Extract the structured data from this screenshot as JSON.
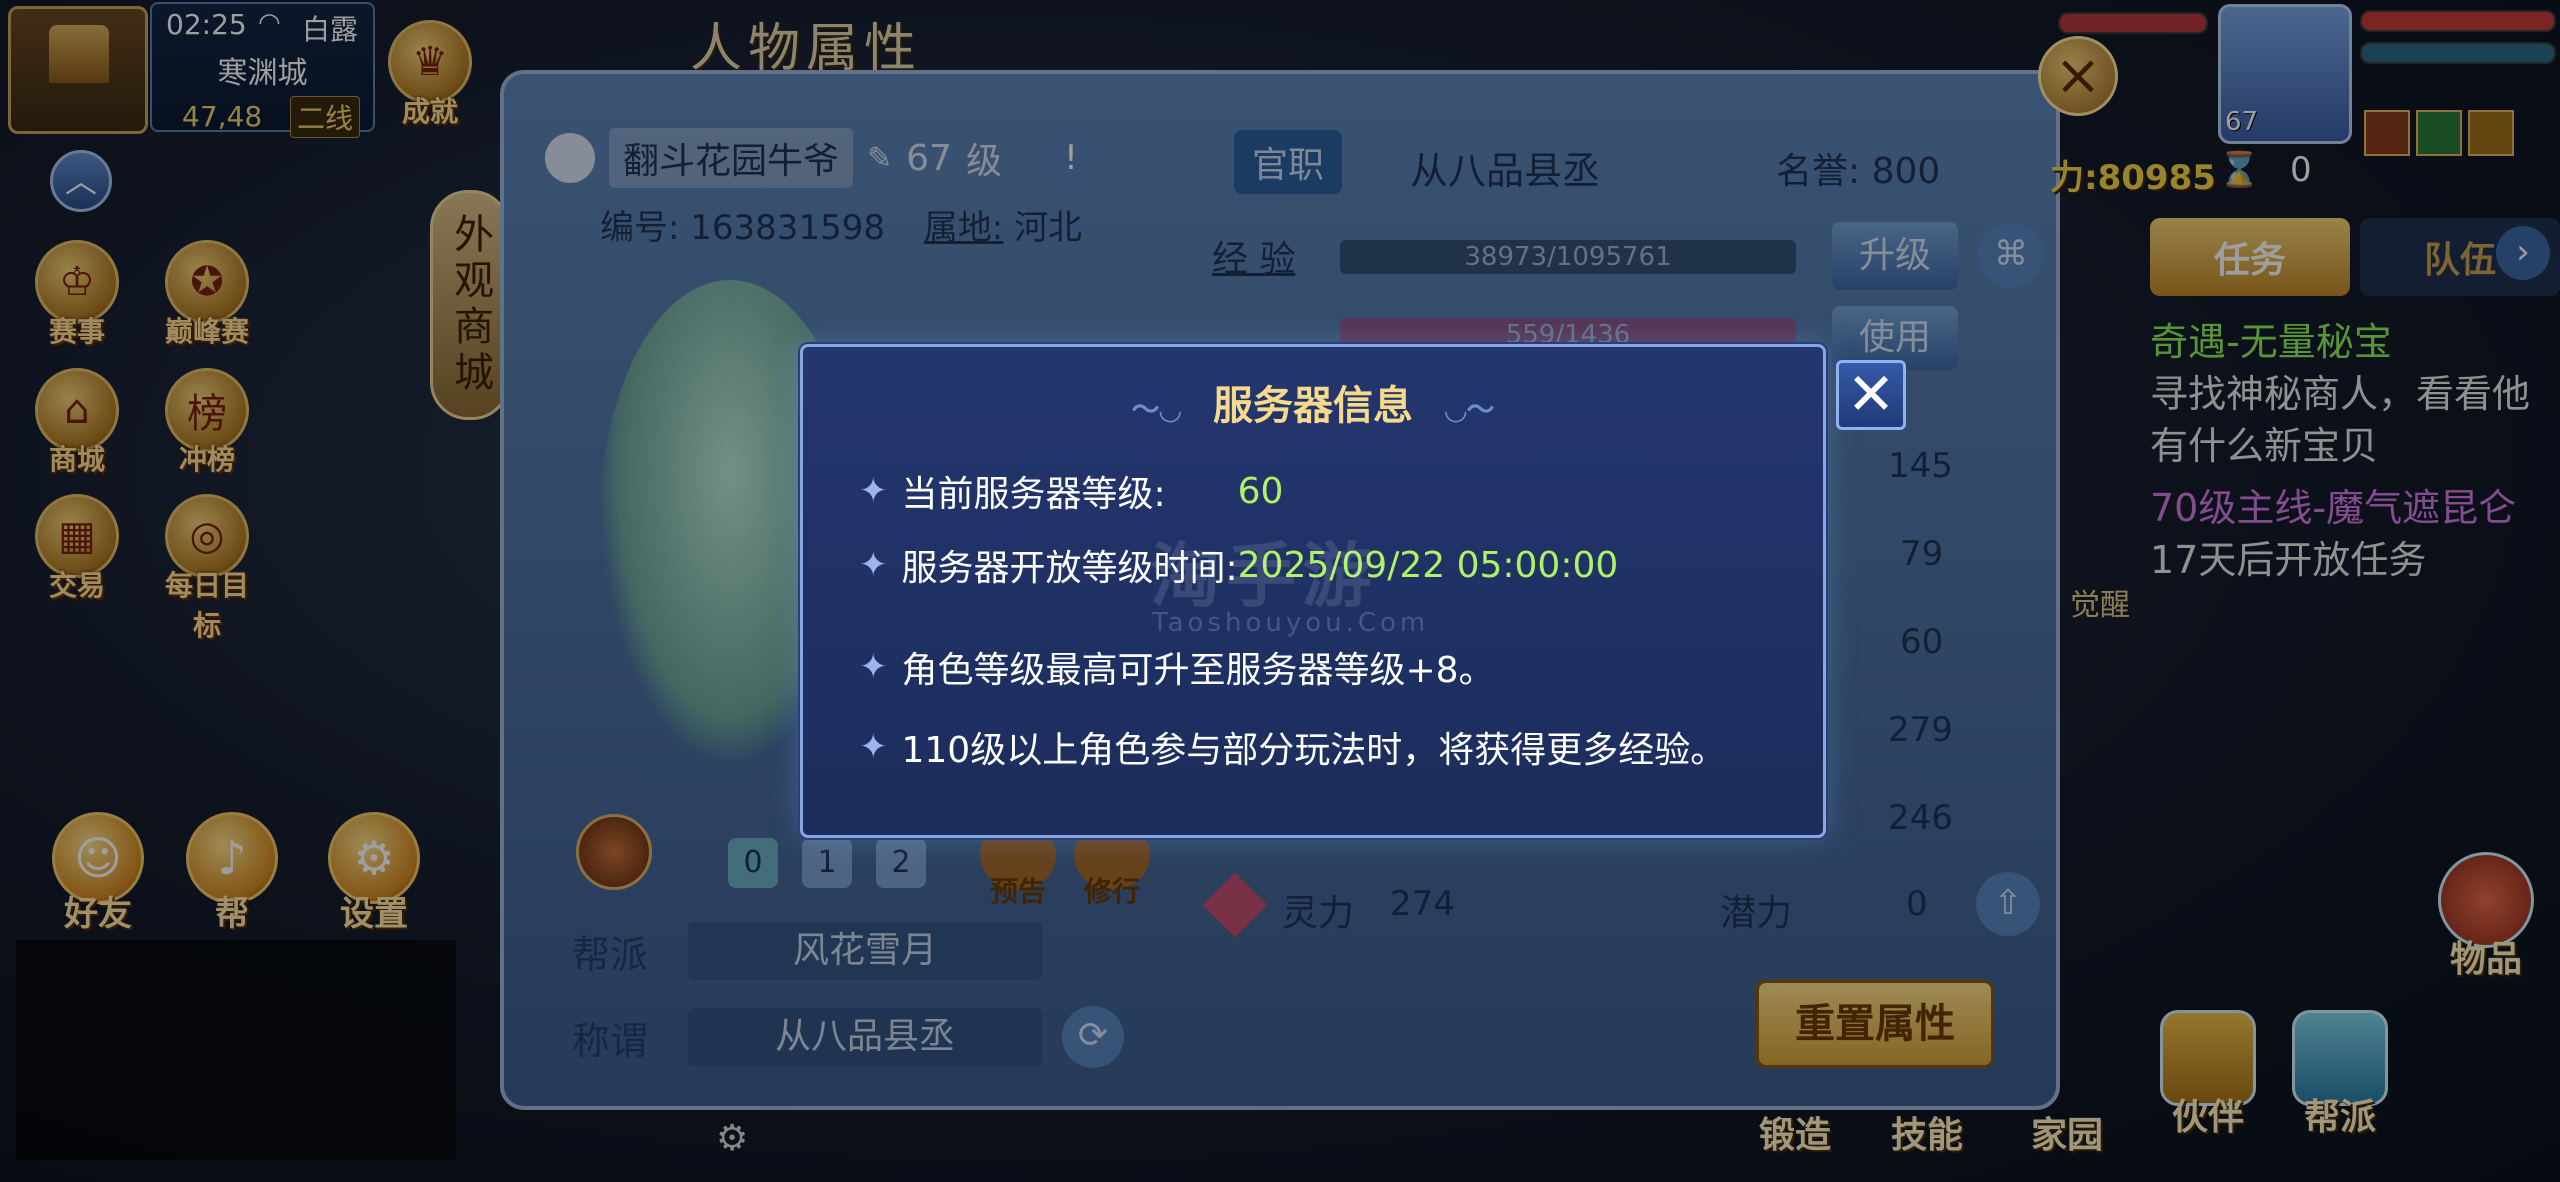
{
  "status_bar": {
    "time": "02:25",
    "weather": "白露",
    "city": "寒渊城",
    "coords": "47,48",
    "line": "二线"
  },
  "left_menu": {
    "achievement": "成就",
    "events": "赛事",
    "peak": "巅峰赛",
    "shop": "商城",
    "ranking": "冲榜",
    "trade": "交易",
    "daily_goal": "每日目标",
    "appearance_shop": "外观商城",
    "friends": "好友",
    "help": "帮",
    "settings": "设置"
  },
  "attribute_panel": {
    "title": "人物属性",
    "player_name": "翻斗花园牛爷",
    "level_num": "67",
    "level_unit": "级",
    "id_label": "编号:",
    "id_value": "163831598",
    "region_label": "属地:",
    "region_value": "河北",
    "official_tag": "官职",
    "official_title": "从八品县丞",
    "reputation": "名誉: 800",
    "exp_label": "经 验",
    "exp_value": "38973/1095761",
    "upgrade_btn": "升级",
    "vitality_value": "559/1436",
    "use_btn": "使用",
    "stats": [
      "145",
      "79",
      "60",
      "279",
      "246"
    ],
    "spirit_label": "灵力",
    "spirit_value": "274",
    "potential_label": "潜力",
    "potential_value": "0",
    "tabs": [
      "0",
      "1",
      "2"
    ],
    "preview": "预告",
    "cultivate": "修行",
    "guild_label": "帮派",
    "guild_value": "风花雪月",
    "title_label": "称谓",
    "title_value": "从八品县丞",
    "reset_btn": "重置属性"
  },
  "right_hud": {
    "avatar_level": "67",
    "score": "力:80985",
    "score_zero": "0",
    "tab_task": "任务",
    "tab_team": "队伍",
    "task_lines": [
      {
        "text": "奇遇-无量秘宝",
        "color": "green"
      },
      {
        "text": "寻找神秘商人，看看他",
        "color": "white"
      },
      {
        "text": "有什么新宝贝",
        "color": "white"
      },
      {
        "text": "70级主线-魔气遮昆仑",
        "color": "purple"
      },
      {
        "text": "17天后开放任务",
        "color": "white"
      }
    ],
    "awaken": "觉醒",
    "item": "物品"
  },
  "bottom_menu": {
    "forge": "锻造",
    "skill": "技能",
    "home": "家园",
    "partner": "伙伴",
    "guild": "帮派"
  },
  "server_modal": {
    "title": "服务器信息",
    "row1_label": "当前服务器等级:",
    "row1_value": "60",
    "row2_label": "服务器开放等级时间:",
    "row2_value": "2025/09/22 05:00:00",
    "row3_text": "角色等级最高可升至服务器等级+8。",
    "row4_text": "110级以上角色参与部分玩法时，将获得更多经验。",
    "close_icon": "close-icon"
  },
  "watermark": {
    "main": "淘手游",
    "sub": "Taoshouyou.Com"
  },
  "colors": {
    "modal_bg": "#23366e",
    "modal_title": "#f6d98a",
    "value_green": "#aef265"
  }
}
